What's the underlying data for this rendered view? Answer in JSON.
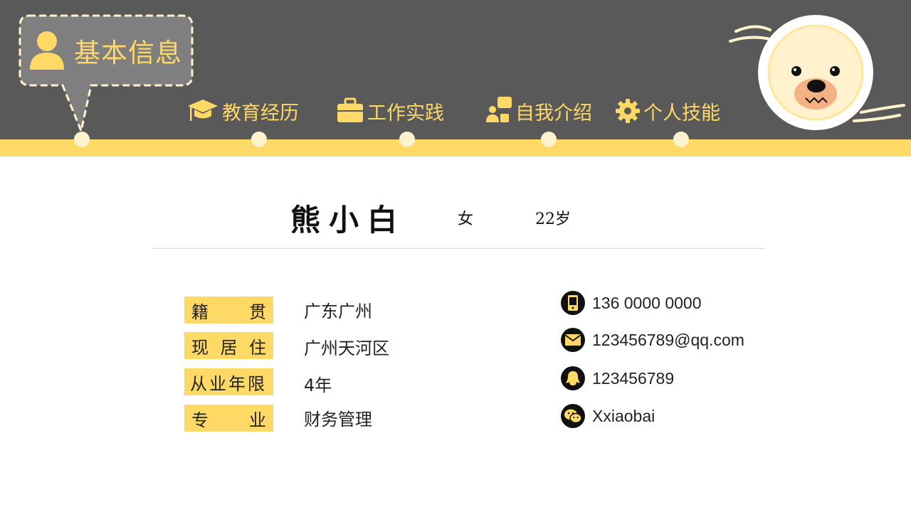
{
  "header": {
    "active_tab": "基本信息",
    "nav": [
      "教育经历",
      "工作实践",
      "自我介绍",
      "个人技能"
    ]
  },
  "profile": {
    "name": "熊小白",
    "gender": "女",
    "age": "22岁"
  },
  "fields": [
    {
      "label_chars": [
        "籍",
        "贯"
      ],
      "value": "广东广州"
    },
    {
      "label_chars": [
        "现",
        "居",
        "住"
      ],
      "value": "广州天河区"
    },
    {
      "label": "从业年限",
      "value": "4年"
    },
    {
      "label_chars": [
        "专",
        "业"
      ],
      "value": "财务管理"
    }
  ],
  "contacts": {
    "phone": "136 0000 0000",
    "email": "123456789@qq.com",
    "qq": "123456789",
    "wechat": "Xxiaobai"
  },
  "colors": {
    "header_bg": "#595959",
    "accent": "#ffd966",
    "dot": "#fff2cc"
  }
}
